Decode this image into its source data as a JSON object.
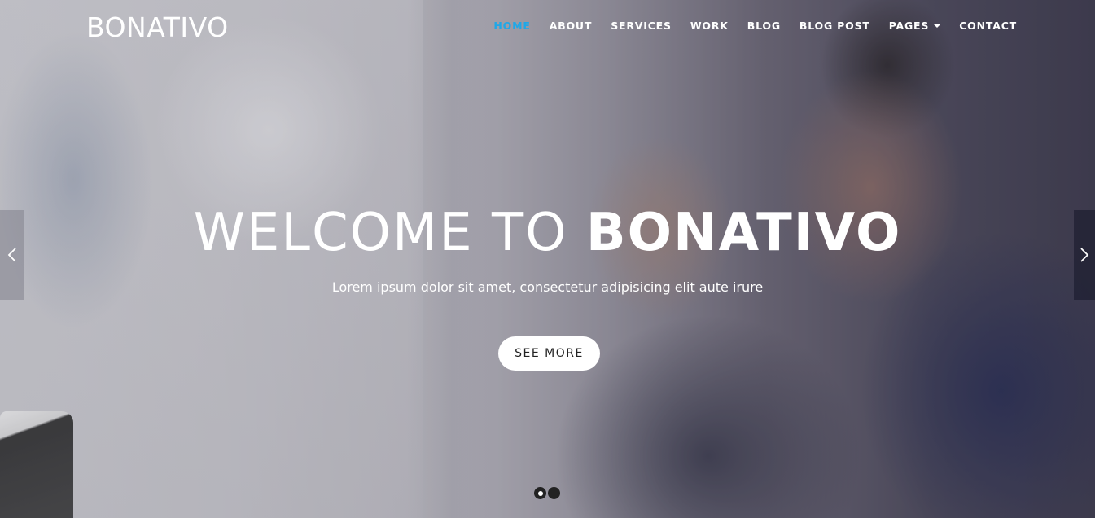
{
  "header": {
    "brand": "BONATIVO",
    "nav": [
      {
        "label": "HOME",
        "active": true
      },
      {
        "label": "ABOUT",
        "active": false
      },
      {
        "label": "SERVICES",
        "active": false
      },
      {
        "label": "WORK",
        "active": false
      },
      {
        "label": "BLOG",
        "active": false
      },
      {
        "label": "BLOG POST",
        "active": false
      },
      {
        "label": "PAGES",
        "active": false,
        "dropdown": true
      },
      {
        "label": "CONTACT",
        "active": false
      }
    ]
  },
  "hero": {
    "title_light": "WELCOME TO",
    "title_bold": "BONATIVO",
    "subtitle": "Lorem ipsum dolor sit amet, consectetur adipisicing elit aute irure",
    "cta_label": "SEE MORE"
  },
  "carousel": {
    "slide_count": 2,
    "active_index": 0,
    "prev_icon": "chevron-left-icon",
    "next_icon": "chevron-right-icon"
  },
  "colors": {
    "accent": "#1fa8e8",
    "text": "#ffffff"
  }
}
